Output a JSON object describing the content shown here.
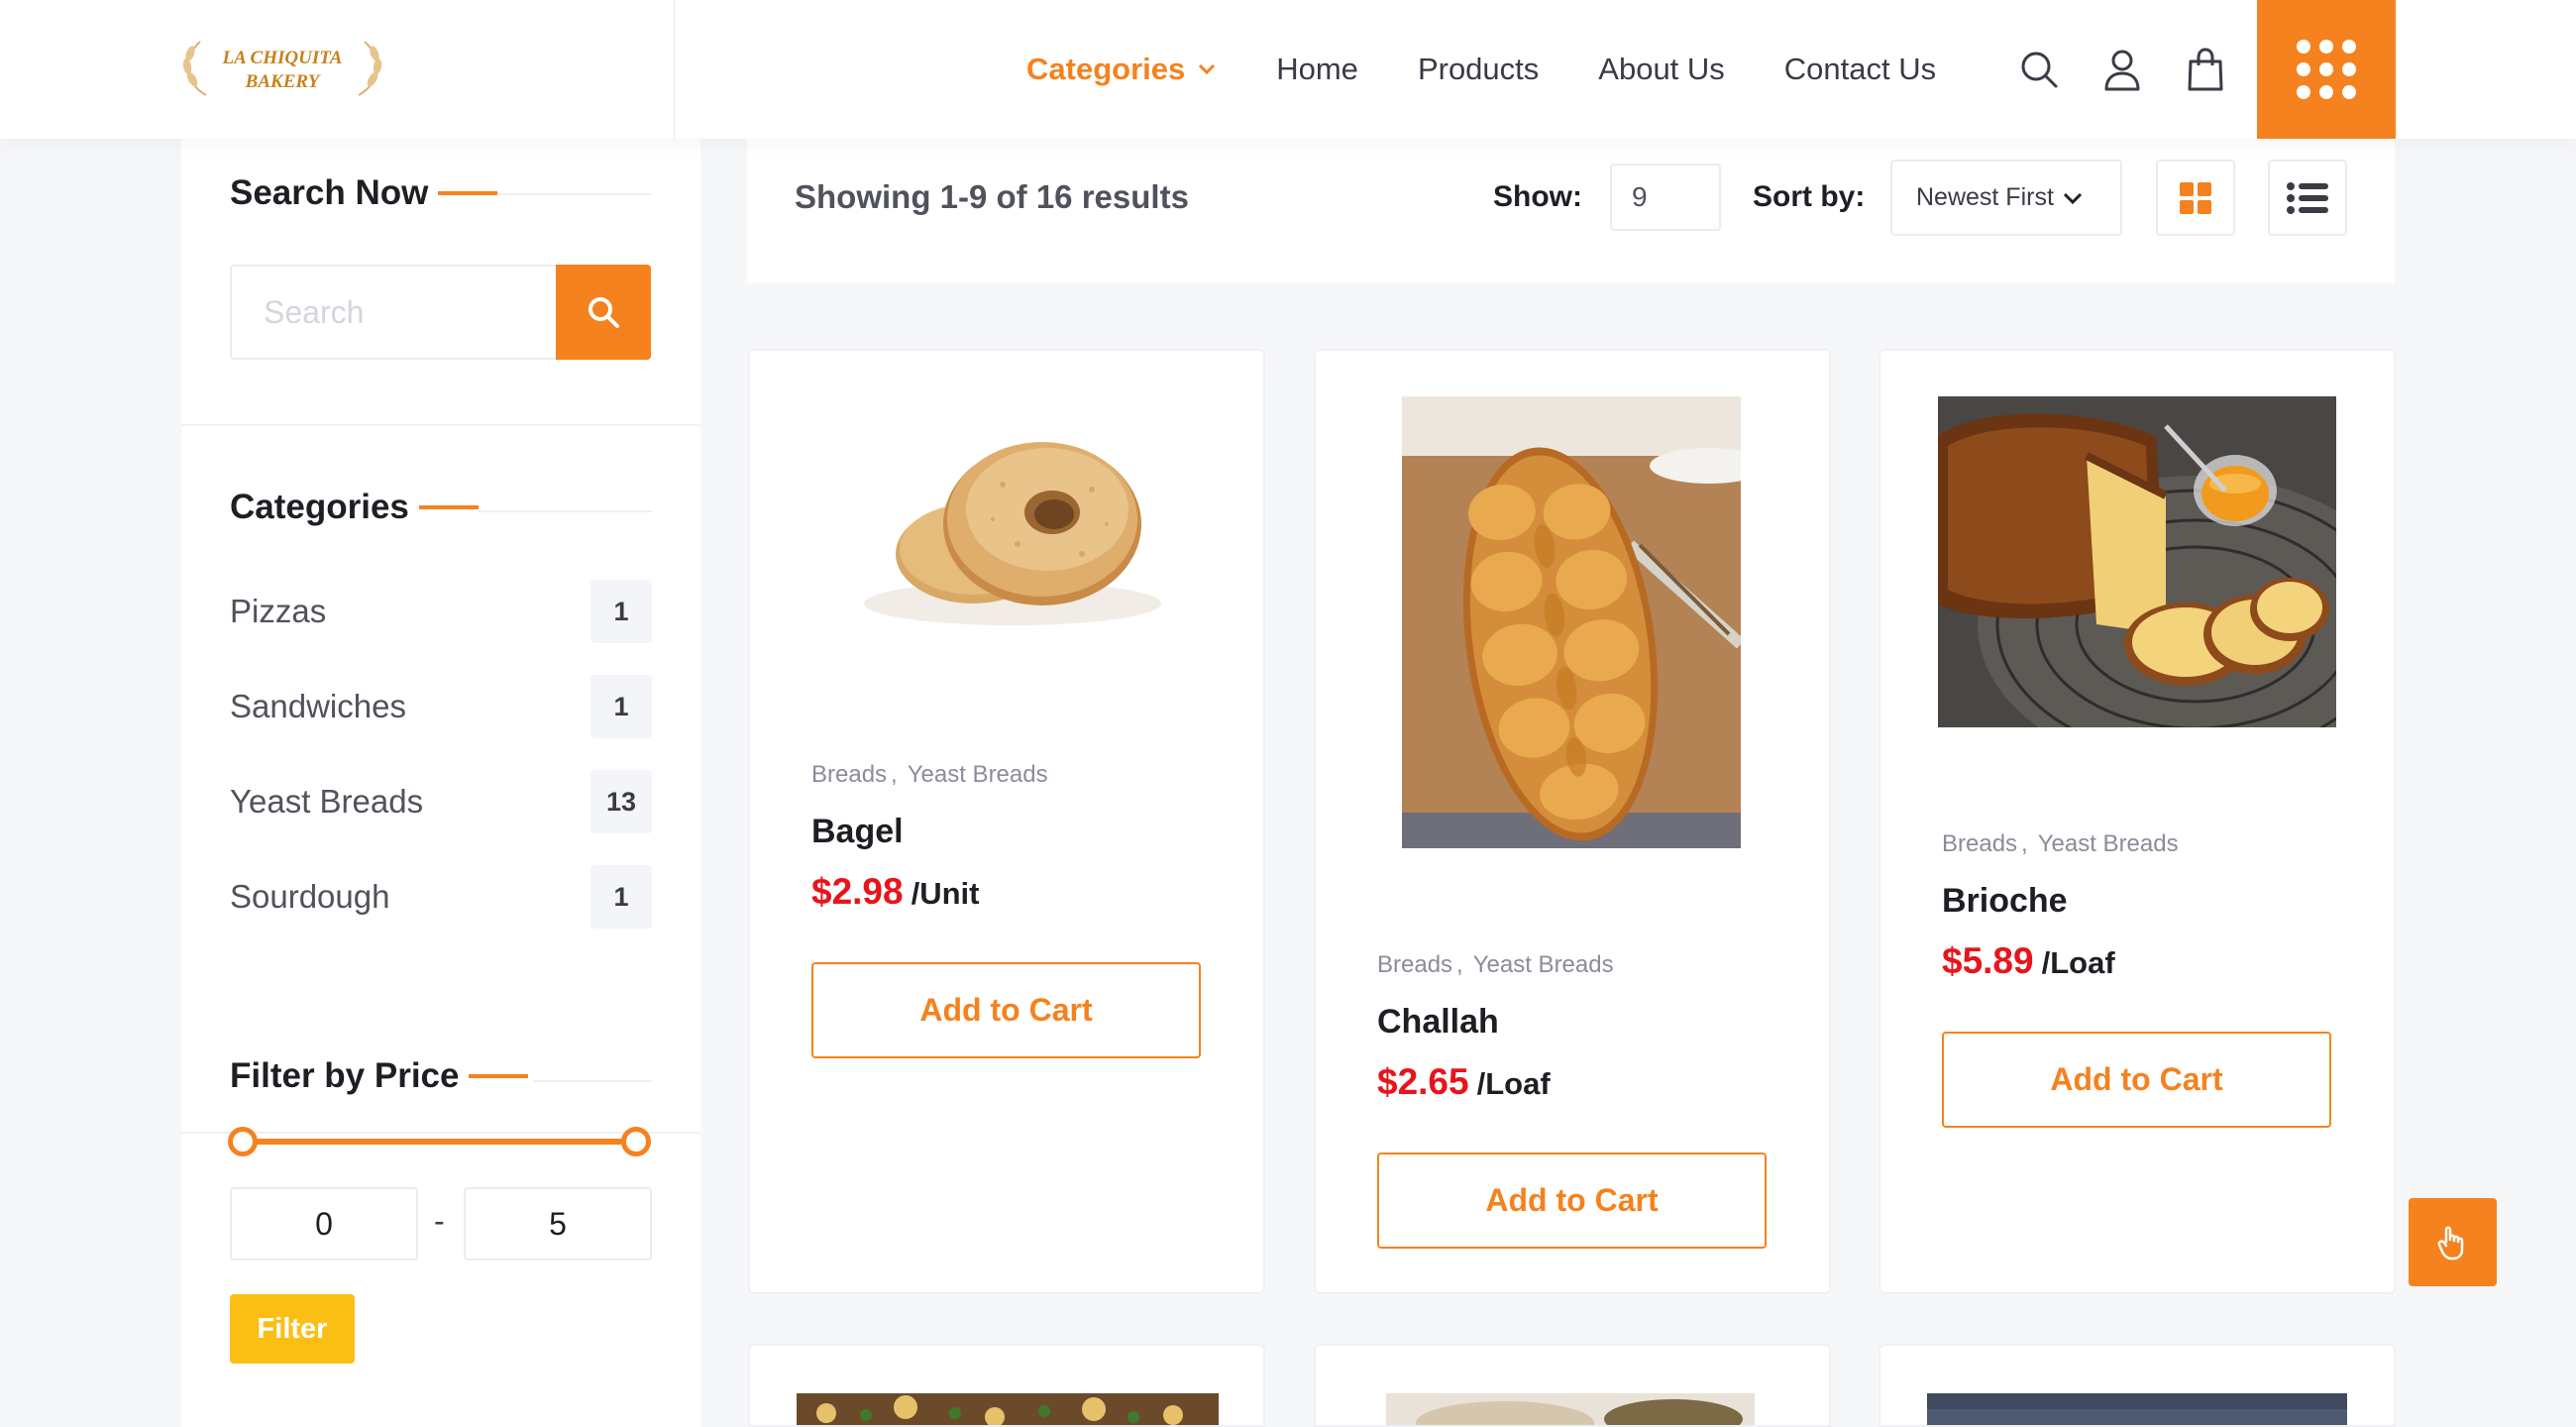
{
  "brand": {
    "logo_text_line1": "LA CHIQUITA",
    "logo_text_line2": "BAKERY"
  },
  "nav": {
    "categories_label": "Categories",
    "home_label": "Home",
    "products_label": "Products",
    "about_label": "About Us",
    "contact_label": "Contact Us"
  },
  "sidebar": {
    "search_title": "Search Now",
    "search_placeholder": "Search",
    "categories_title": "Categories",
    "categories": [
      {
        "name": "Pizzas",
        "count": "1"
      },
      {
        "name": "Sandwiches",
        "count": "1"
      },
      {
        "name": "Yeast Breads",
        "count": "13"
      },
      {
        "name": "Sourdough",
        "count": "1"
      }
    ],
    "filter_title": "Filter by Price",
    "price_min": "0",
    "price_max": "5",
    "price_separator": "-",
    "filter_button": "Filter"
  },
  "toolbar": {
    "results_text": "Showing 1-9 of 16 results",
    "show_label": "Show:",
    "show_value": "9",
    "sort_label": "Sort by:",
    "sort_value": "Newest First"
  },
  "products": [
    {
      "categories": [
        "Breads",
        "Yeast Breads"
      ],
      "name": "Bagel",
      "price": "$2.98",
      "unit": "/Unit",
      "button": "Add to Cart"
    },
    {
      "categories": [
        "Breads",
        "Yeast Breads"
      ],
      "name": "Challah",
      "price": "$2.65",
      "unit": "/Loaf",
      "button": "Add to Cart"
    },
    {
      "categories": [
        "Breads",
        "Yeast Breads"
      ],
      "name": "Brioche",
      "price": "$5.89",
      "unit": "/Loaf",
      "button": "Add to Cart"
    }
  ],
  "colors": {
    "accent": "#f5821f",
    "price_red": "#e8141c",
    "filter_yellow": "#fbbf14"
  },
  "icons": {
    "search": "search-icon",
    "user": "user-icon",
    "cart": "shopping-bag-icon",
    "menu": "grid-dots-icon",
    "grid_view": "grid-view-icon",
    "list_view": "list-view-icon",
    "float": "hand-pointer-icon"
  }
}
